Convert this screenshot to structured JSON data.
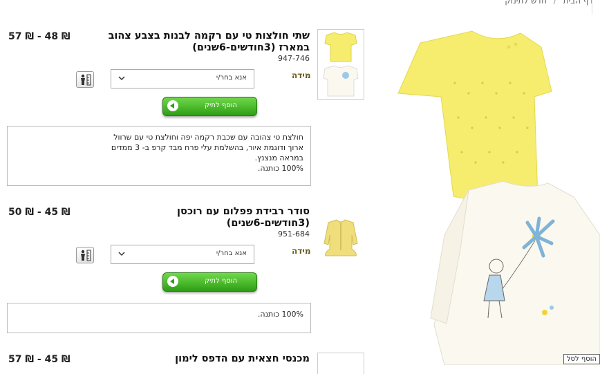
{
  "breadcrumb": {
    "items": [
      "דף הבית",
      "חדש לתינוק"
    ]
  },
  "products": [
    {
      "title_line1": "שתי חולצות טי עם רקמה לבנות בצבע צהוב",
      "title_line2": "במארז (3חודשים-6שנים)",
      "price": "57 ₪ - 48 ₪",
      "code": "947-746",
      "size_label": "מידה",
      "select_value": "אנא בחר/י",
      "add_label": "הוסף לתיק",
      "description": "חולצת טי צהובה עם שכבת רקמה יפה וחולצת טי עם שרוול ארוך ודוגמת איור, בהשלמת עלי פרח מבד קרפ ב- 3 ממדים במראה מנצנץ.\n100% כותנה."
    },
    {
      "title_line1": "סודר רבידת פפלום עם רוכסן",
      "title_line2": "(3חודשים-6שנים)",
      "price": "50 ₪ - 45 ₪",
      "code": "951-684",
      "size_label": "מידה",
      "select_value": "אנא בחר/י",
      "add_label": "הוסף לתיק",
      "description": "100% כותנה."
    },
    {
      "title_line1": "מכנסי חצאית עם הדפס לימון",
      "price": "57 ₪ - 45 ₪"
    }
  ],
  "hover_tag": "הוסף לסל",
  "colors": {
    "accent_green": "#2f9e15",
    "shirt_yellow": "#f6ec6e"
  }
}
